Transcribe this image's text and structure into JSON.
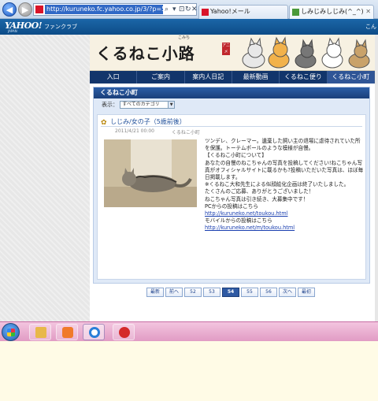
{
  "browser": {
    "url": "http://kuruneko.fc.yahoo.co.jp/3/?p=54",
    "tabs": [
      {
        "label": "Yahoo!メール"
      },
      {
        "label": "しみじみしじみ(^_^)"
      }
    ]
  },
  "yahoo_header": {
    "logo": "YAHOO!",
    "logo_sub": "JAPAN",
    "section": "ファンクラブ",
    "greeting": "こん"
  },
  "site": {
    "logo": "くるねこ小路",
    "logo_ruby": "こみち",
    "badge": "アニメ"
  },
  "nav": {
    "items": [
      "入口",
      "ご案内",
      "案内人日記",
      "最新動画",
      "くるねこ便り",
      "くるねこ小町"
    ],
    "active_index": 5
  },
  "panel": {
    "title": "くるねこ小町",
    "filter_label": "表示：",
    "filter_value": "すべてのカテゴリ"
  },
  "article": {
    "title": "しじみ/女の子（5歳前後）",
    "date": "2011/4/21 00:00",
    "author": "くるねこ小町",
    "body": [
      "ツンデレ、クレーマー。遺棄した飼い主の退場に虐待されていた所を保護。トーテムポールのような模様が自慢。",
      "",
      "【くるねこ小町について】",
      "あなたの自慢のねこちゃんの写真を投稿してください!ねこちゃん写真がオフィシャルサイトに載るかも?投稿いただいた写真は、ほぼ毎日掲載します。",
      "※くるねこ大和先生による似顔絵化企画は終了いたしました。",
      "たくさんのご応募、ありがとうございました！",
      "ねこちゃん写真は引き続き、大募集中です！",
      "PCからの投稿はこちら"
    ],
    "pc_link": "http://kuruneko.net/toukou.html",
    "mobile_label": "モバイルからの投稿はこちら",
    "mobile_link": "http://kuruneko.net/m/toukou.html"
  },
  "pagination": {
    "first": "最新",
    "prev": "前へ",
    "pages": [
      "52",
      "53",
      "54",
      "55",
      "56"
    ],
    "current": "54",
    "next": "次へ",
    "last": "最初"
  }
}
